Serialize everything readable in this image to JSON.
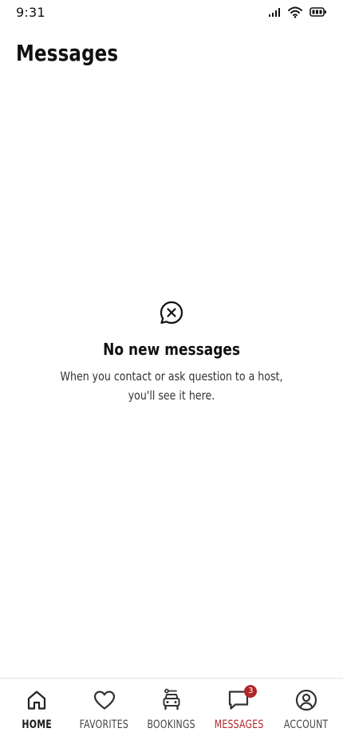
{
  "status_bar": {
    "time": "9:31",
    "icons": [
      "cellular-signal-icon",
      "wifi-icon",
      "battery-icon"
    ]
  },
  "header": {
    "title": "Messages"
  },
  "empty_state": {
    "icon": "chat-close-icon",
    "title": "No new messages",
    "line1": "When you contact or ask question to a host,",
    "line2": "you'll see it here."
  },
  "tab_bar": {
    "accent_color": "#b0262b",
    "tabs": [
      {
        "id": "home",
        "label": "HOME",
        "icon": "home-icon"
      },
      {
        "id": "favorites",
        "label": "FAVORITES",
        "icon": "heart-icon"
      },
      {
        "id": "bookings",
        "label": "BOOKINGS",
        "icon": "car-icon"
      },
      {
        "id": "messages",
        "label": "MESSAGES",
        "icon": "chat-icon",
        "badge": "3",
        "active": true
      },
      {
        "id": "account",
        "label": "ACCOUNT",
        "icon": "account-icon"
      }
    ]
  }
}
